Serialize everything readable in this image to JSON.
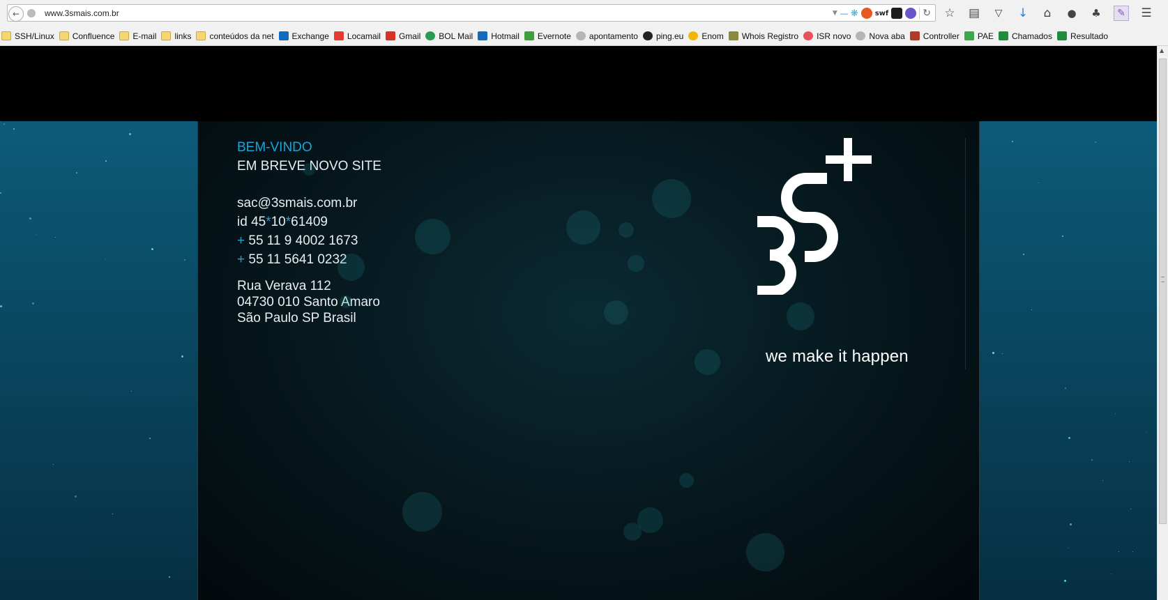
{
  "browser": {
    "url": "www.3smais.com.br",
    "ext_swf": "swf"
  },
  "bookmarks": [
    {
      "label": "SSH/Linux",
      "icon": "folder"
    },
    {
      "label": "Confluence",
      "icon": "folder"
    },
    {
      "label": "E-mail",
      "icon": "folder"
    },
    {
      "label": "links",
      "icon": "folder"
    },
    {
      "label": "conteúdos da net",
      "icon": "folder"
    },
    {
      "label": "Exchange",
      "icon": "outlook-icon"
    },
    {
      "label": "Locamail",
      "icon": "locamail-icon"
    },
    {
      "label": "Gmail",
      "icon": "gmail-icon"
    },
    {
      "label": "BOL Mail",
      "icon": "bol-icon"
    },
    {
      "label": "Hotmail",
      "icon": "outlook-icon"
    },
    {
      "label": "Evernote",
      "icon": "evernote-icon"
    },
    {
      "label": "apontamento",
      "icon": "globe-icon"
    },
    {
      "label": "ping.eu",
      "icon": "penguin-icon"
    },
    {
      "label": "Enom",
      "icon": "enom-icon"
    },
    {
      "label": "Whois Registro",
      "icon": "whois-icon"
    },
    {
      "label": "ISR novo",
      "icon": "isr-icon"
    },
    {
      "label": "Nova aba",
      "icon": "globe-icon"
    },
    {
      "label": "Controller",
      "icon": "controller-icon"
    },
    {
      "label": "PAE",
      "icon": "pae-icon"
    },
    {
      "label": "Chamados",
      "icon": "sheet-icon"
    },
    {
      "label": "Resultado",
      "icon": "sheet-icon"
    }
  ],
  "content": {
    "welcome": "BEM-VINDO",
    "coming_soon": "EM BREVE NOVO SITE",
    "email": "sac@3smais.com.br",
    "id_prefix": "id 45",
    "id_star1": "*",
    "id_mid": "10",
    "id_star2": "*",
    "id_suffix": "61409",
    "phone_plus": "+",
    "phone1": " 55 11 9 4002 1673",
    "phone2": " 55 11 5641 0232",
    "address_line1": "Rua Verava  112",
    "address_line2": "04730  010   Santo Amaro",
    "address_line3": "São Paulo  SP  Brasil",
    "tagline": "we make it happen"
  },
  "colors": {
    "accent": "#1aa6d9",
    "teal_bg": "#0c5b7a",
    "panel_bg": "#061a20"
  }
}
